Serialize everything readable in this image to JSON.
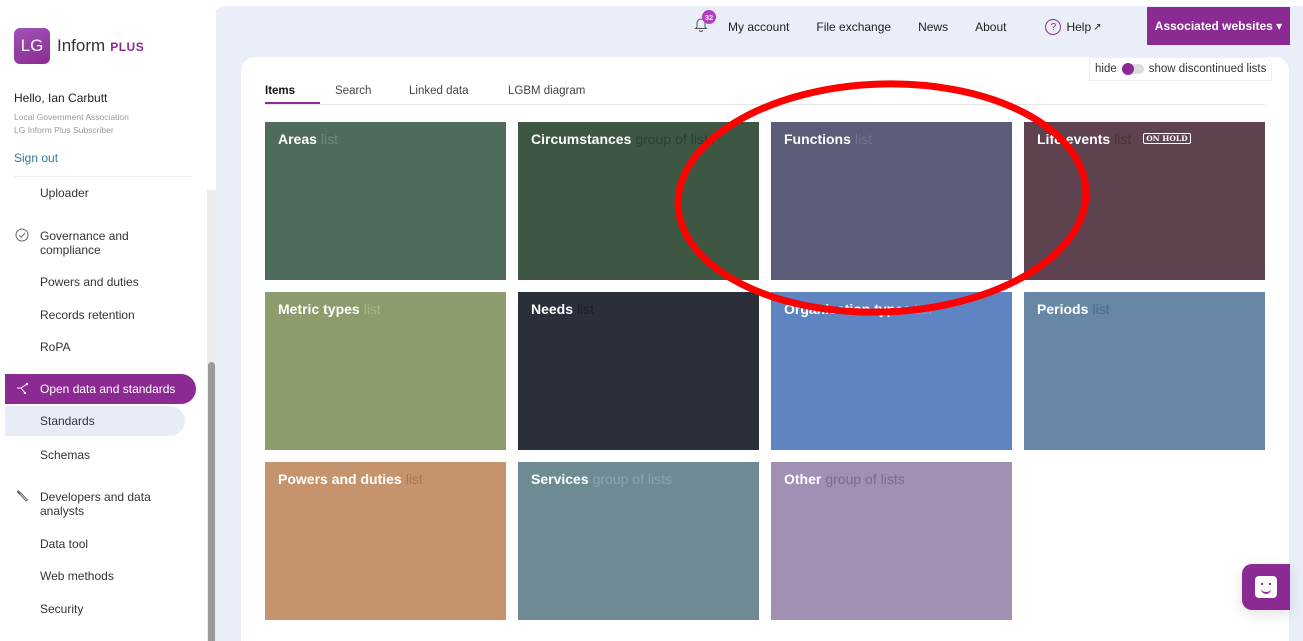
{
  "brand": {
    "badge": "LG",
    "name": "Inform",
    "suffix": "PLUS"
  },
  "user": {
    "greeting": "Hello, Ian Carbutt",
    "organisation": "Local Government Association",
    "role": "LG Inform Plus Subscriber",
    "sign_out": "Sign out"
  },
  "sidebar": {
    "items": [
      {
        "label": "Uploader"
      },
      {
        "label": "Governance and compliance",
        "icon": "check-circle-icon"
      },
      {
        "label": "Powers and duties"
      },
      {
        "label": "Records retention"
      },
      {
        "label": "RoPA"
      },
      {
        "label": "Open data and standards",
        "icon": "network-icon",
        "active": true
      },
      {
        "label": "Standards",
        "selected": true
      },
      {
        "label": "Schemas"
      },
      {
        "label": "Developers and data analysts",
        "icon": "wrench-icon"
      },
      {
        "label": "Data tool"
      },
      {
        "label": "Web methods"
      },
      {
        "label": "Security"
      }
    ]
  },
  "topnav": {
    "notifications_count": "32",
    "links": [
      "My account",
      "File exchange",
      "News",
      "About"
    ],
    "help": "Help",
    "associated": "Associated websites ▾"
  },
  "toggle": {
    "left": "hide",
    "right": "show discontinued lists",
    "state": "hide"
  },
  "tabs": [
    "Items",
    "Search",
    "Linked data",
    "LGBM diagram"
  ],
  "active_tab": "Items",
  "tiles": [
    {
      "title": "Areas",
      "kind": "list",
      "color": "#4f6b5c",
      "kind_color": "#6d8a7c"
    },
    {
      "title": "Circumstances",
      "kind": "group of lists",
      "color": "#3e5742",
      "kind_color": "#2c3f30"
    },
    {
      "title": "Functions",
      "kind": "list",
      "color": "#5b5c78",
      "kind_color": "#73749a"
    },
    {
      "title": "Life events",
      "kind": "list",
      "badge": "ON HOLD",
      "color": "#5e424f",
      "kind_color": "#47313b"
    },
    {
      "title": "Metric types",
      "kind": "list",
      "color": "#8d9c6d",
      "kind_color": "#a6b488"
    },
    {
      "title": "Needs",
      "kind": "list",
      "color": "#2b2f39",
      "kind_color": "#1b1e25"
    },
    {
      "title": "Organisation types",
      "kind": "list",
      "color": "#5e84c2",
      "kind_color": "#7a9dd6"
    },
    {
      "title": "Periods",
      "kind": "list",
      "color": "#6887a7",
      "kind_color": "#4f6b88"
    },
    {
      "title": "Powers and duties",
      "kind": "list",
      "color": "#c6946c",
      "kind_color": "#a87550"
    },
    {
      "title": "Services",
      "kind": "group of lists",
      "color": "#6e8b93",
      "kind_color": "#88a5ad"
    },
    {
      "title": "Other",
      "kind": "group of lists",
      "color": "#a290b4",
      "kind_color": "#7b6b8f"
    }
  ],
  "annotation": {
    "shape": "ellipse",
    "color": "#ff0000",
    "target": "Functions"
  }
}
